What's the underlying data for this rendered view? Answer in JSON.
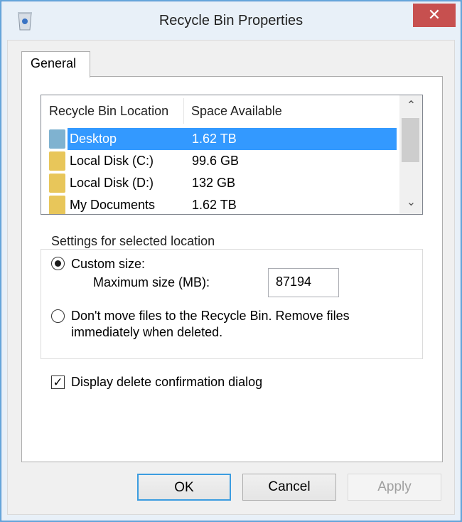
{
  "window": {
    "title": "Recycle Bin Properties",
    "close_icon": "close-icon"
  },
  "tabs": [
    {
      "label": "General",
      "active": true
    }
  ],
  "list": {
    "columns": [
      "Recycle Bin Location",
      "Space Available"
    ],
    "rows": [
      {
        "name": "Desktop",
        "space": "1.62 TB",
        "selected": true
      },
      {
        "name": "Local Disk (C:)",
        "space": "99.6 GB"
      },
      {
        "name": "Local Disk (D:)",
        "space": "132 GB"
      },
      {
        "name": "My Documents",
        "space": "1.62 TB"
      }
    ]
  },
  "settings": {
    "legend": "Settings for selected location",
    "custom_size_label": "Custom size:",
    "custom_size_selected": true,
    "max_size_label": "Maximum size (MB):",
    "max_size_value": "87194",
    "dont_move_line1": "Don't move files to the Recycle Bin. Remove files",
    "dont_move_line2": "immediately when deleted.",
    "dont_move_selected": false
  },
  "confirm": {
    "label": "Display delete confirmation dialog",
    "checked": true
  },
  "buttons": {
    "ok": "OK",
    "cancel": "Cancel",
    "apply": "Apply"
  },
  "colors": {
    "selection": "#3399ff",
    "close": "#c7504f",
    "folder": "#e8c65a",
    "desktop_folder": "#7fb2d0"
  }
}
